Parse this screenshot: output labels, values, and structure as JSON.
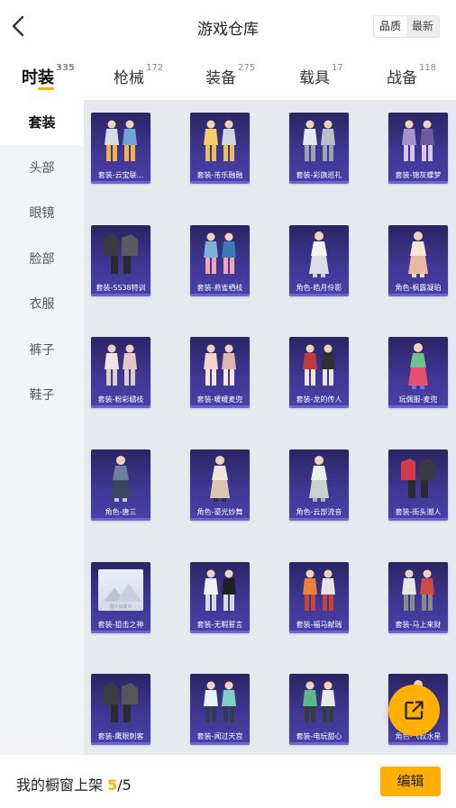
{
  "header": {
    "title": "游戏仓库",
    "sort_options": [
      "品质",
      "最新"
    ]
  },
  "tabs": [
    {
      "label": "时装",
      "count": "335"
    },
    {
      "label": "枪械",
      "count": "172"
    },
    {
      "label": "装备",
      "count": "275"
    },
    {
      "label": "载具",
      "count": "17"
    },
    {
      "label": "战备",
      "count": "118"
    }
  ],
  "sidebar": {
    "items": [
      "套装",
      "头部",
      "眼镜",
      "脸部",
      "衣服",
      "裤子",
      "鞋子"
    ]
  },
  "items": [
    {
      "name": "套装-云宝联...",
      "icon": "outfit-figure"
    },
    {
      "name": "套装-芾乐融融",
      "icon": "outfit-figure"
    },
    {
      "name": "套装-彩旗巡礼",
      "icon": "outfit-figure"
    },
    {
      "name": "套装-锦灰蝶梦",
      "icon": "outfit-figure"
    },
    {
      "name": "套装-SS38特训",
      "icon": "outfit-clothes"
    },
    {
      "name": "套装-燕雀栖枝",
      "icon": "outfit-figure"
    },
    {
      "name": "角色-皓月伶影",
      "icon": "character-figure"
    },
    {
      "name": "角色-枫露凝珀",
      "icon": "character-figure"
    },
    {
      "name": "套装-粉彩缱枝",
      "icon": "outfit-figure"
    },
    {
      "name": "套装-暖暖麦兜",
      "icon": "outfit-figure"
    },
    {
      "name": "套装-龙的传人",
      "icon": "outfit-figure"
    },
    {
      "name": "玩偶服-麦兜",
      "icon": "mascot-figure"
    },
    {
      "name": "角色-唐三",
      "icon": "character-figure"
    },
    {
      "name": "角色-鎏光妙舞",
      "icon": "character-figure"
    },
    {
      "name": "角色-云部流音",
      "icon": "character-figure"
    },
    {
      "name": "套装-街头潮人",
      "icon": "outfit-clothes"
    },
    {
      "name": "套装-狙击之神",
      "icon": "image-placeholder",
      "placeholder_text": "图片加载中"
    },
    {
      "name": "套装-无暇誓言",
      "icon": "outfit-figure"
    },
    {
      "name": "套装-福马献瑞",
      "icon": "outfit-figure"
    },
    {
      "name": "套装-马上来财",
      "icon": "outfit-figure"
    },
    {
      "name": "套装-鹰眼刺客",
      "icon": "outfit-clothes"
    },
    {
      "name": "套装-闻过天宫",
      "icon": "outfit-figure"
    },
    {
      "name": "套装-电玩甜心",
      "icon": "outfit-figure"
    },
    {
      "name": "角色-飞叔水星",
      "icon": "character-figure"
    }
  ],
  "footer": {
    "label": "我的橱窗上架",
    "current": "5",
    "separator": "/",
    "total": "5",
    "edit_label": "编辑"
  },
  "fab": {
    "icon": "share-external-icon"
  },
  "colors": {
    "accent": "#ffb000",
    "card_bg": "#3b3289",
    "sidebar_bg": "#f2f4f7",
    "grid_bg": "#e6e9ee"
  }
}
